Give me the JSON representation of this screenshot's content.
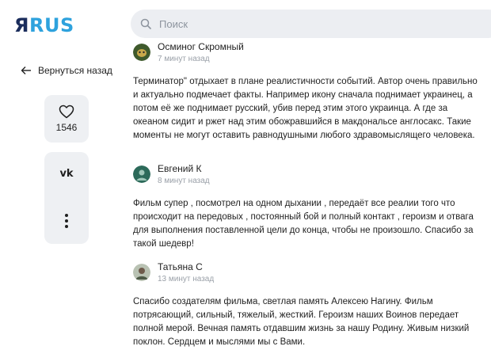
{
  "header": {
    "logo_ya": "Я",
    "logo_rus": "RUS",
    "search_placeholder": "Поиск"
  },
  "sidebar": {
    "back_label": "Вернуться назад",
    "likes_count": "1546",
    "share_vk": "vk"
  },
  "comments": [
    {
      "author": "Осминог Скромный",
      "time": "7 минут назад",
      "text": "Терминатор\" отдыхает в плане реалистичности событий. Автор очень правильно и актуально подмечает факты. Например икону сначала поднимает украинец, а потом её же поднимает русский, убив перед этим этого украинца. А где за океаном сидит и ржет над этим обожравшийся в макдональсе англосакс. Такие моменты не могут оставить равнодушными любого здравомыслящего человека."
    },
    {
      "author": "Евгений К",
      "time": "8 минут назад",
      "text": "Фильм супер , посмотрел на одном дыхании , передаёт все реалии того что происходит на передовых , постоянный бой и полный контакт , героизм и отвага для выполнения поставленной цели до конца, чтобы не произошло. Спасибо за такой шедевр!"
    },
    {
      "author": "Татьяна С",
      "time": "13 минут назад",
      "text": "Спасибо создателям фильма, светлая память Алексею Нагину. Фильм потрясающий, сильный, тяжелый, жесткий. Героизм наших Воинов передает полной мерой. Вечная память отдавшим жизнь за нашу Родину. Живым низкий поклон. Сердцем и мыслями мы с Вами."
    }
  ],
  "colors": {
    "logo_dark": "#1b2d5c",
    "logo_accent": "#2ea2dd",
    "panel_bg": "#eef0f3",
    "muted_text": "#9aa0a8"
  },
  "icons": [
    "search-icon",
    "arrow-left-icon",
    "heart-icon",
    "vk-icon",
    "more-vertical-icon"
  ]
}
